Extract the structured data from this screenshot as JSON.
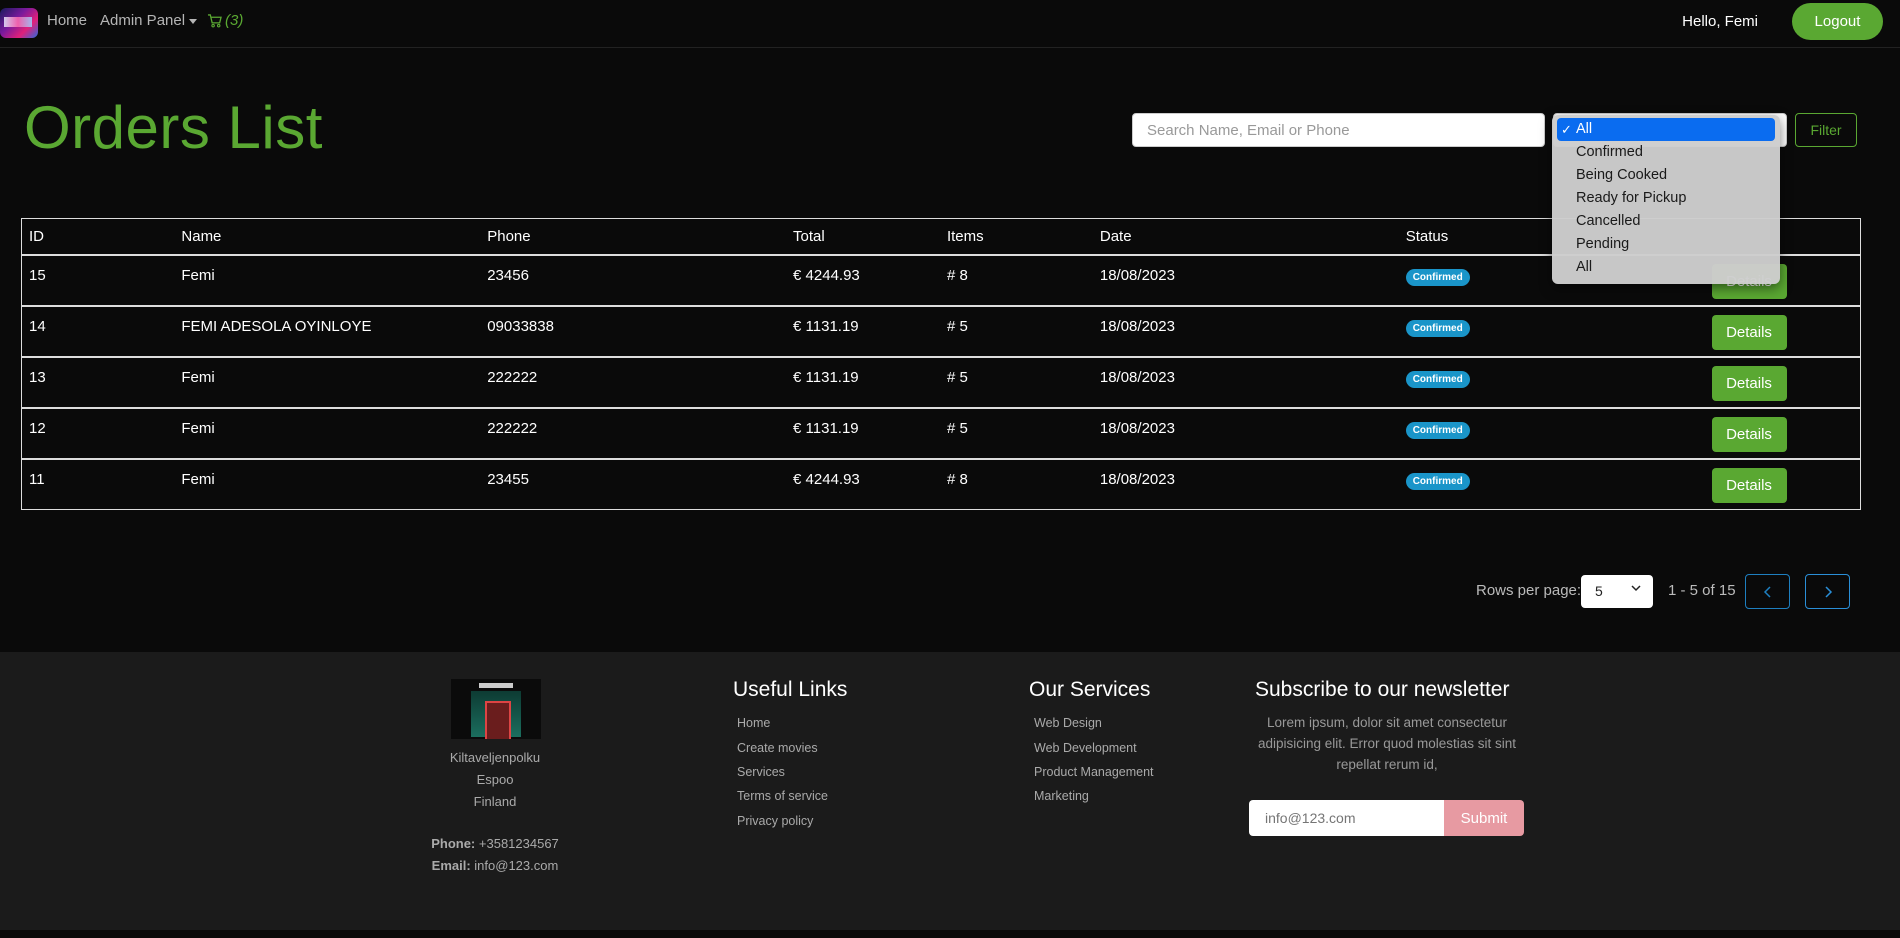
{
  "nav": {
    "home": "Home",
    "admin_panel": "Admin Panel",
    "cart_count": "(3)",
    "greeting": "Hello, Femi",
    "logout": "Logout"
  },
  "header": {
    "title": "Orders List",
    "search_placeholder": "Search Name, Email or Phone",
    "filter": "Filter"
  },
  "status_dropdown": {
    "selected": "All",
    "options": [
      "All",
      "Confirmed",
      "Being Cooked",
      "Ready for Pickup",
      "Cancelled",
      "Pending",
      "All"
    ]
  },
  "table": {
    "columns": [
      "ID",
      "Name",
      "Phone",
      "Total",
      "Items",
      "Date",
      "Status",
      ""
    ],
    "rows": [
      {
        "id": "15",
        "name": "Femi",
        "phone": "23456",
        "total": "€ 4244.93",
        "items": "# 8",
        "date": "18/08/2023",
        "status": "Confirmed",
        "action": "Details"
      },
      {
        "id": "14",
        "name": "FEMI ADESOLA OYINLOYE",
        "phone": "09033838",
        "total": "€ 1131.19",
        "items": "# 5",
        "date": "18/08/2023",
        "status": "Confirmed",
        "action": "Details"
      },
      {
        "id": "13",
        "name": "Femi",
        "phone": "222222",
        "total": "€ 1131.19",
        "items": "# 5",
        "date": "18/08/2023",
        "status": "Confirmed",
        "action": "Details"
      },
      {
        "id": "12",
        "name": "Femi",
        "phone": "222222",
        "total": "€ 1131.19",
        "items": "# 5",
        "date": "18/08/2023",
        "status": "Confirmed",
        "action": "Details"
      },
      {
        "id": "11",
        "name": "Femi",
        "phone": "23455",
        "total": "€ 4244.93",
        "items": "# 8",
        "date": "18/08/2023",
        "status": "Confirmed",
        "action": "Details"
      }
    ]
  },
  "pagination": {
    "rows_per_page_label": "Rows per page:",
    "rows_per_page": "5",
    "range": "1 - 5 of 15"
  },
  "footer": {
    "address": [
      "Kiltaveljenpolku",
      "Espoo",
      "Finland"
    ],
    "phone_label": "Phone:",
    "phone": "+3581234567",
    "email_label": "Email:",
    "email": "info@123.com",
    "useful_links_title": "Useful Links",
    "useful_links": [
      "Home",
      "Create movies",
      "Services",
      "Terms of service",
      "Privacy policy"
    ],
    "services_title": "Our Services",
    "services": [
      "Web Design",
      "Web Development",
      "Product Management",
      "Marketing"
    ],
    "newsletter_title": "Subscribe to our newsletter",
    "newsletter_text": "Lorem ipsum, dolor sit amet consectetur adipisicing elit. Error quod molestias sit sint repellat rerum id,",
    "newsletter_placeholder": "info@123.com",
    "submit": "Submit"
  },
  "colors": {
    "accent_green": "#5aa832",
    "badge_blue": "#1a95c9",
    "submit_pink": "#e79aa2",
    "dropdown_highlight": "#0a6cf0"
  }
}
